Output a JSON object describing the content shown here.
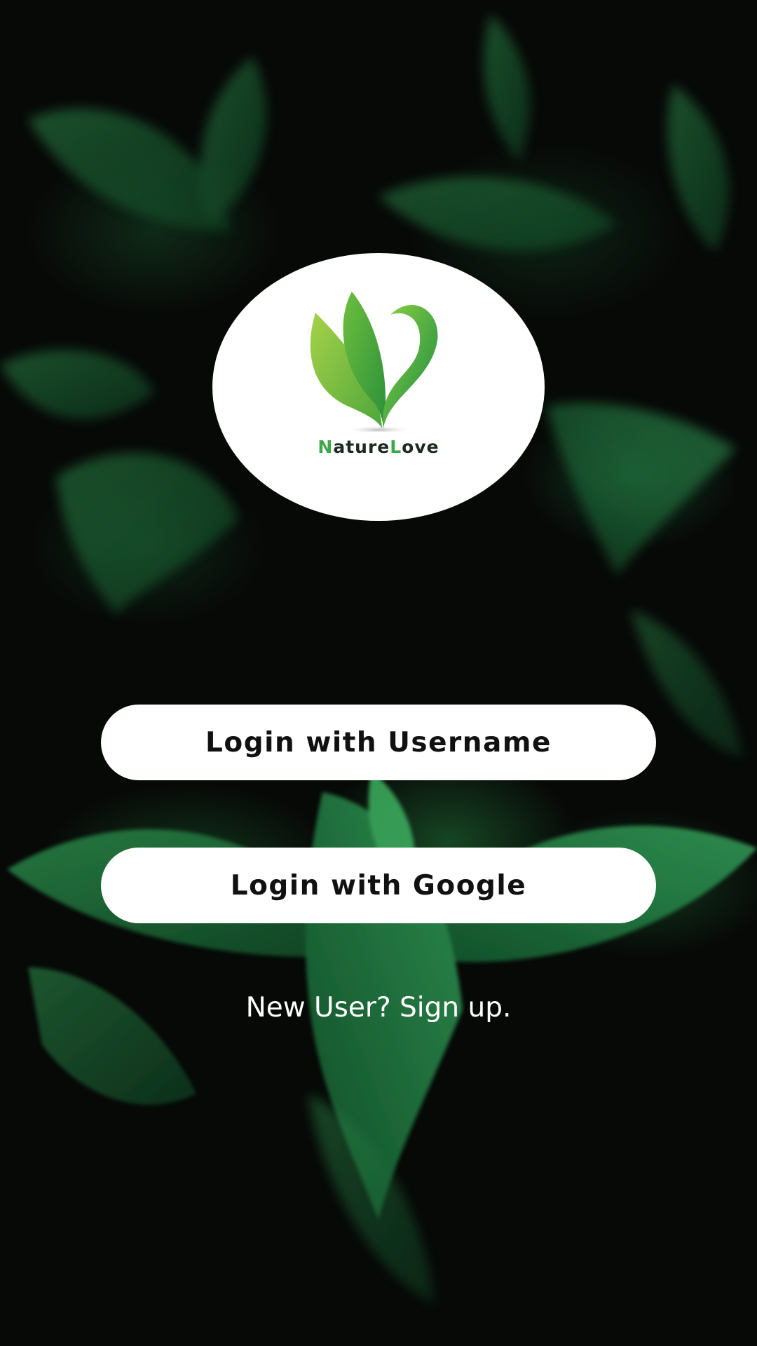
{
  "app": {
    "logo_name": "NatureLove",
    "logo_first_letter": "N",
    "logo_middle": "ature",
    "logo_second_letter": "L",
    "logo_end": "ove"
  },
  "actions": {
    "login_username_label": "Login with Username",
    "login_google_label": "Login with Google",
    "signup_label": "New User? Sign up."
  },
  "colors": {
    "background": "#070907",
    "leaf_green": "#1f7a3e",
    "logo_green_light": "#8cc63f",
    "logo_green_dark": "#1e9a46",
    "button_bg": "#ffffff",
    "button_text": "#111111"
  },
  "icons": {
    "logo": "leaf-heart-icon"
  }
}
